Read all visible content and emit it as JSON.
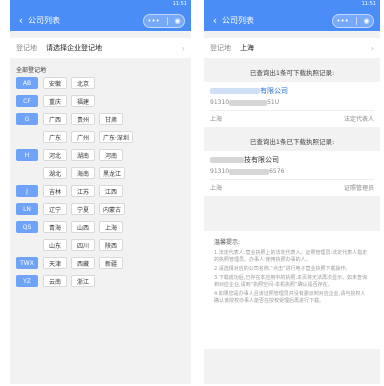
{
  "left": {
    "status": {
      "left": "",
      "right": "11:51"
    },
    "nav": {
      "title": "公司列表"
    },
    "register": {
      "label": "登记地",
      "placeholder": "请选择企业登记地"
    },
    "section_title": "全部登记地",
    "groups": [
      {
        "key": "AB",
        "cities": [
          "安徽",
          "北京"
        ]
      },
      {
        "key": "CF",
        "cities": [
          "重庆",
          "福建"
        ]
      },
      {
        "key": "G",
        "cities": [
          "广西",
          "贵州",
          "甘肃",
          "广东",
          "广州",
          "广东·深圳"
        ]
      },
      {
        "key": "H",
        "cities": [
          "河北",
          "湖南",
          "河南",
          "湖北",
          "海南",
          "黑龙江"
        ]
      },
      {
        "key": "J",
        "cities": [
          "吉林",
          "江苏",
          "江西"
        ]
      },
      {
        "key": "LN",
        "cities": [
          "辽宁",
          "宁夏",
          "内蒙古"
        ]
      },
      {
        "key": "QS",
        "cities": [
          "青海",
          "山西",
          "上海",
          "山东",
          "四川",
          "陕西"
        ]
      },
      {
        "key": "TWX",
        "cities": [
          "天津",
          "西藏",
          "新疆"
        ]
      },
      {
        "key": "YZ",
        "cities": [
          "云南",
          "浙江"
        ]
      }
    ]
  },
  "right": {
    "status": {
      "left": "",
      "right": "11:51"
    },
    "nav": {
      "title": "公司列表"
    },
    "register": {
      "label": "登记地",
      "value": "上海"
    },
    "result1": {
      "head": "已查询出1条可下载执照记录:",
      "name_suffix": "有限公司",
      "code_prefix": "91310",
      "code_suffix": "51U",
      "location": "上海",
      "role": "法定代表人"
    },
    "result2": {
      "head": "已查询出1条已下载执照记录:",
      "name_suffix": "技有限公司",
      "code_prefix": "91310",
      "code_suffix": "6576",
      "location": "上海",
      "role": "证照管理员"
    },
    "tips": {
      "title": "温馨提示:",
      "items": [
        "1.法定代表人:营业执照上的法定代表人。证照管理员:法定代表人指定的执照管理员。办事人:使用执照办事的人。",
        "2.请选择对应的公司名称,“点击”进行电子营业执照下载操作。",
        "3.下载成功后,已存在本应用中的执照,本页将无法再次显示。如未查询到对应企业,请到“执照空间-本机执照”确认是否存在。",
        "4.如果您是办事人且该证照管理员并没有委派到对应企业,请与授权人确认该授权办事人能否在授权受理后再进行下载。"
      ]
    }
  }
}
